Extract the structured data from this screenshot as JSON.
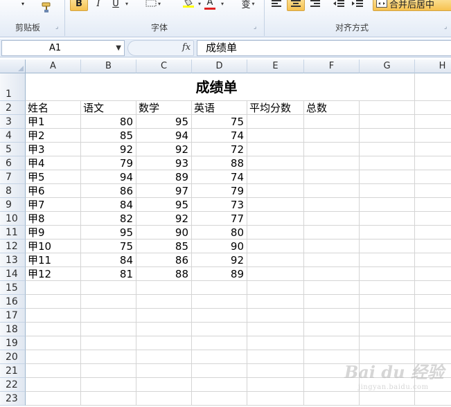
{
  "ribbon": {
    "groups": [
      {
        "label": "剪贴板"
      },
      {
        "label": "字体"
      },
      {
        "label": "对齐方式"
      }
    ],
    "font_buttons": {
      "bold": "B",
      "italic": "I",
      "underline": "U",
      "font_color": "A",
      "phonetic": "变"
    },
    "merge_label": "合并后居中"
  },
  "formula_bar": {
    "name_box": "A1",
    "fx_label": "fx",
    "formula": "成绩单"
  },
  "columns": [
    "A",
    "B",
    "C",
    "D",
    "E",
    "F",
    "G",
    "H"
  ],
  "rows": [
    "1",
    "2",
    "3",
    "4",
    "5",
    "6",
    "7",
    "8",
    "9",
    "10",
    "11",
    "12",
    "13",
    "14",
    "15",
    "16",
    "17",
    "18",
    "19",
    "20",
    "21",
    "22",
    "23"
  ],
  "sheet": {
    "title": "成绩单",
    "headers": [
      "姓名",
      "语文",
      "数学",
      "英语",
      "平均分数",
      "总数"
    ],
    "records": [
      {
        "name": "甲1",
        "chinese": "80",
        "math": "95",
        "english": "75"
      },
      {
        "name": "甲2",
        "chinese": "85",
        "math": "94",
        "english": "74"
      },
      {
        "name": "甲3",
        "chinese": "92",
        "math": "92",
        "english": "72"
      },
      {
        "name": "甲4",
        "chinese": "79",
        "math": "93",
        "english": "88"
      },
      {
        "name": "甲5",
        "chinese": "94",
        "math": "89",
        "english": "74"
      },
      {
        "name": "甲6",
        "chinese": "86",
        "math": "97",
        "english": "79"
      },
      {
        "name": "甲7",
        "chinese": "84",
        "math": "95",
        "english": "73"
      },
      {
        "name": "甲8",
        "chinese": "82",
        "math": "92",
        "english": "77"
      },
      {
        "name": "甲9",
        "chinese": "95",
        "math": "90",
        "english": "80"
      },
      {
        "name": "甲10",
        "chinese": "75",
        "math": "85",
        "english": "90"
      },
      {
        "name": "甲11",
        "chinese": "84",
        "math": "86",
        "english": "92"
      },
      {
        "name": "甲12",
        "chinese": "81",
        "math": "88",
        "english": "89"
      }
    ]
  },
  "watermark": {
    "brand": "Bai du 经验",
    "url": "jingyan.baidu.com"
  },
  "colors": {
    "highlight": "#f6c14f",
    "font_color_bar": "#e02020",
    "fill_color_bar": "#ffff00"
  }
}
